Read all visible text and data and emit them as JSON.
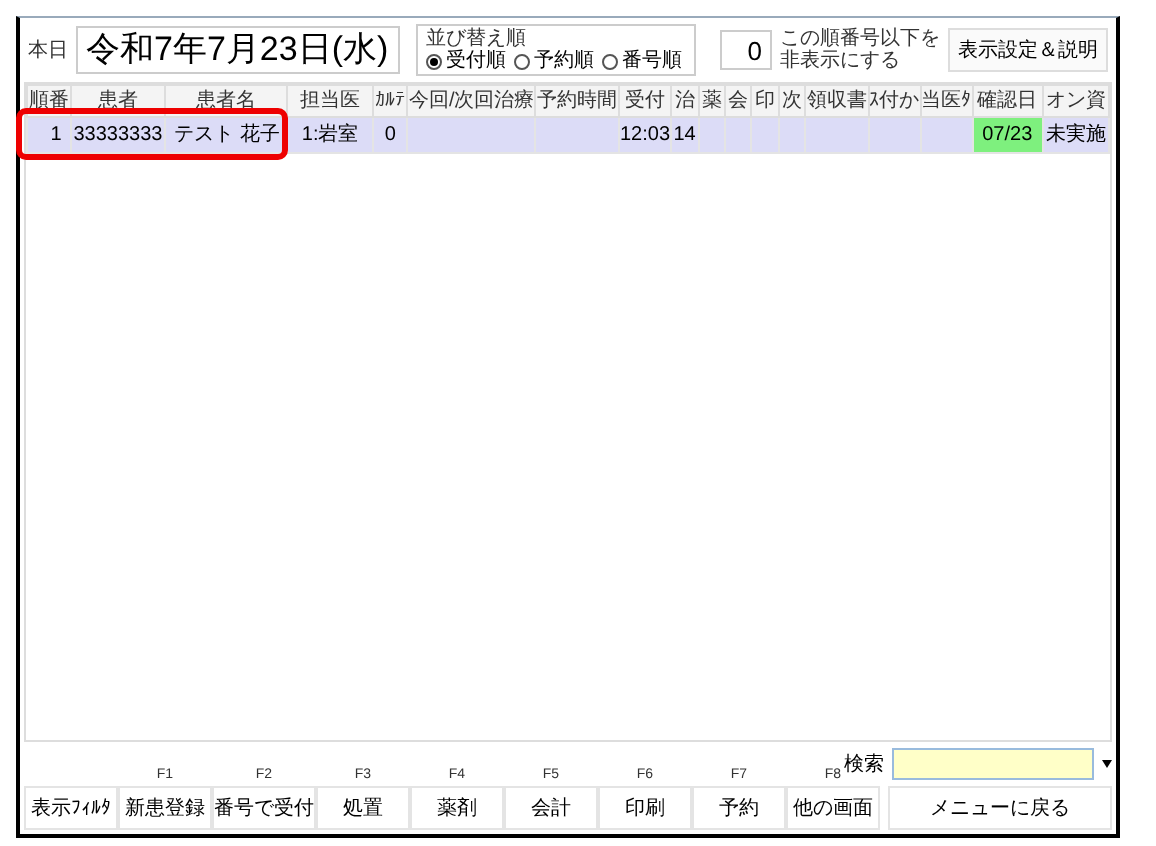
{
  "header": {
    "today_label": "本日",
    "date": "令和7年7月23日(水)",
    "sort": {
      "legend": "並び替え順",
      "options": [
        {
          "label": "受付順",
          "selected": true
        },
        {
          "label": "予約順",
          "selected": false
        },
        {
          "label": "番号順",
          "selected": false
        }
      ]
    },
    "hide_below": {
      "value": "0",
      "label_lines": [
        "この順番号以下を",
        "非表示にする"
      ]
    },
    "settings_button": "表示設定＆説明"
  },
  "table": {
    "columns": [
      "順番",
      "患者",
      "患者名",
      "担当医",
      "ｶﾙﾃ",
      "今回/次回治療",
      "予約時間",
      "受付",
      "治",
      "薬",
      "会",
      "印",
      "次",
      "領収書",
      "ｽ付か",
      "当医ﾀ",
      "確認日",
      "オン資"
    ],
    "rows": [
      {
        "selected": true,
        "cells": [
          "1",
          "33333333",
          "テスト 花子",
          "1:岩室",
          "0",
          "",
          "",
          "12:03",
          "14",
          "",
          "",
          "",
          "",
          "",
          "",
          "",
          "07/23",
          "未実施"
        ],
        "confirmed": true
      }
    ]
  },
  "function_keys": [
    {
      "label": "表示ﾌｨﾙﾀ"
    },
    {
      "key": "F1",
      "label": "新患登録"
    },
    {
      "key": "F2",
      "label": "番号で受付"
    },
    {
      "key": "F3",
      "label": "処置"
    },
    {
      "key": "F4",
      "label": "薬剤"
    },
    {
      "key": "F5",
      "label": "会計"
    },
    {
      "key": "F6",
      "label": "印刷"
    },
    {
      "key": "F7",
      "label": "予約"
    },
    {
      "key": "F8",
      "label": "他の画面"
    }
  ],
  "search": {
    "label": "検索"
  },
  "menu_button": "メニューに戻る"
}
